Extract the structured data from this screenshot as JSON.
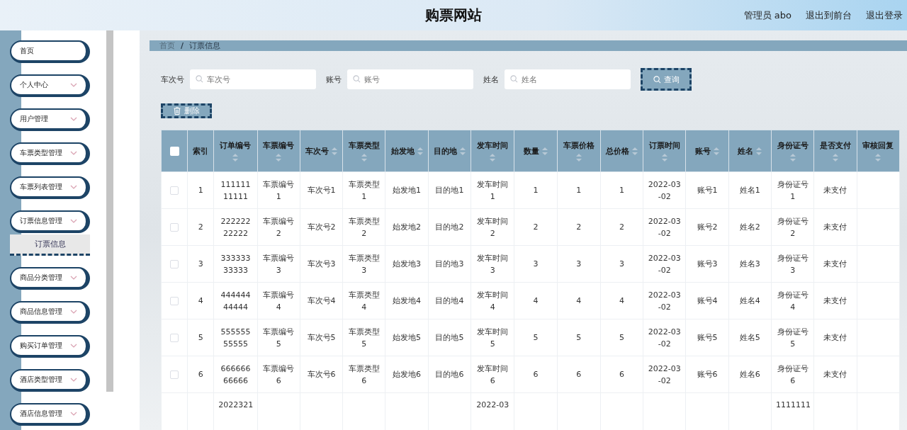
{
  "header": {
    "title": "购票网站",
    "links": [
      "管理员 abo",
      "退出到前台",
      "退出登录"
    ]
  },
  "sidebar": {
    "items": [
      {
        "label": "首页",
        "kind": "link"
      },
      {
        "label": "个人中心",
        "kind": "menu"
      },
      {
        "label": "用户管理",
        "kind": "menu"
      },
      {
        "label": "车票类型管理",
        "kind": "menu"
      },
      {
        "label": "车票列表管理",
        "kind": "menu"
      },
      {
        "label": "订票信息管理",
        "kind": "menu",
        "children": [
          {
            "label": "订票信息",
            "selected": true
          }
        ]
      },
      {
        "label": "商品分类管理",
        "kind": "menu"
      },
      {
        "label": "商品信息管理",
        "kind": "menu"
      },
      {
        "label": "购买订单管理",
        "kind": "menu"
      },
      {
        "label": "酒店类型管理",
        "kind": "menu"
      },
      {
        "label": "酒店信息管理",
        "kind": "menu"
      }
    ]
  },
  "breadcrumb": {
    "items": [
      "首页",
      "订票信息"
    ],
    "separator": "/"
  },
  "search": {
    "fields": [
      {
        "label": "车次号",
        "placeholder": "车次号"
      },
      {
        "label": "账号",
        "placeholder": "账号"
      },
      {
        "label": "姓名",
        "placeholder": "姓名"
      }
    ],
    "button": "查询"
  },
  "actions": {
    "delete": "删除"
  },
  "table": {
    "all_checked": false,
    "columns": [
      {
        "label": "索引",
        "sortable": false
      },
      {
        "label": "订单编号",
        "sortable": true
      },
      {
        "label": "车票编号",
        "sortable": true
      },
      {
        "label": "车次号",
        "sortable": true
      },
      {
        "label": "车票类型",
        "sortable": true
      },
      {
        "label": "始发地",
        "sortable": true
      },
      {
        "label": "目的地",
        "sortable": true
      },
      {
        "label": "发车时间",
        "sortable": true
      },
      {
        "label": "数量",
        "sortable": true
      },
      {
        "label": "车票价格",
        "sortable": true
      },
      {
        "label": "总价格",
        "sortable": true
      },
      {
        "label": "订票时间",
        "sortable": true
      },
      {
        "label": "账号",
        "sortable": true
      },
      {
        "label": "姓名",
        "sortable": true
      },
      {
        "label": "身份证号",
        "sortable": true
      },
      {
        "label": "是否支付",
        "sortable": true
      },
      {
        "label": "审核回复",
        "sortable": true
      }
    ],
    "rows": [
      {
        "checked": false,
        "cells": [
          "1",
          "11111111111",
          "车票编号1",
          "车次号1",
          "车票类型1",
          "始发地1",
          "目的地1",
          "发车时间1",
          "1",
          "1",
          "1",
          "2022-03-02",
          "账号1",
          "姓名1",
          "身份证号1",
          "未支付",
          null
        ]
      },
      {
        "checked": false,
        "cells": [
          "2",
          "22222222222",
          "车票编号2",
          "车次号2",
          "车票类型2",
          "始发地2",
          "目的地2",
          "发车时间2",
          "2",
          "2",
          "2",
          "2022-03-02",
          "账号2",
          "姓名2",
          "身份证号2",
          "未支付",
          null
        ]
      },
      {
        "checked": false,
        "cells": [
          "3",
          "33333333333",
          "车票编号3",
          "车次号3",
          "车票类型3",
          "始发地3",
          "目的地3",
          "发车时间3",
          "3",
          "3",
          "3",
          "2022-03-02",
          "账号3",
          "姓名3",
          "身份证号3",
          "未支付",
          null
        ]
      },
      {
        "checked": false,
        "cells": [
          "4",
          "44444444444",
          "车票编号4",
          "车次号4",
          "车票类型4",
          "始发地4",
          "目的地4",
          "发车时间4",
          "4",
          "4",
          "4",
          "2022-03-02",
          "账号4",
          "姓名4",
          "身份证号4",
          "未支付",
          null
        ]
      },
      {
        "checked": false,
        "cells": [
          "5",
          "55555555555",
          "车票编号5",
          "车次号5",
          "车票类型5",
          "始发地5",
          "目的地5",
          "发车时间5",
          "5",
          "5",
          "5",
          "2022-03-02",
          "账号5",
          "姓名5",
          "身份证号5",
          "未支付",
          null
        ]
      },
      {
        "checked": false,
        "cells": [
          "6",
          "66666666666",
          "车票编号6",
          "车次号6",
          "车票类型6",
          "始发地6",
          "目的地6",
          "发车时间6",
          "6",
          "6",
          "6",
          "2022-03-02",
          "账号6",
          "姓名6",
          "身份证号6",
          "未支付",
          null
        ]
      },
      {
        "partial": true,
        "cells": [
          null,
          "2022321",
          null,
          null,
          null,
          null,
          null,
          "2022-03",
          null,
          null,
          null,
          null,
          null,
          null,
          "1111111",
          null,
          null
        ]
      }
    ]
  }
}
